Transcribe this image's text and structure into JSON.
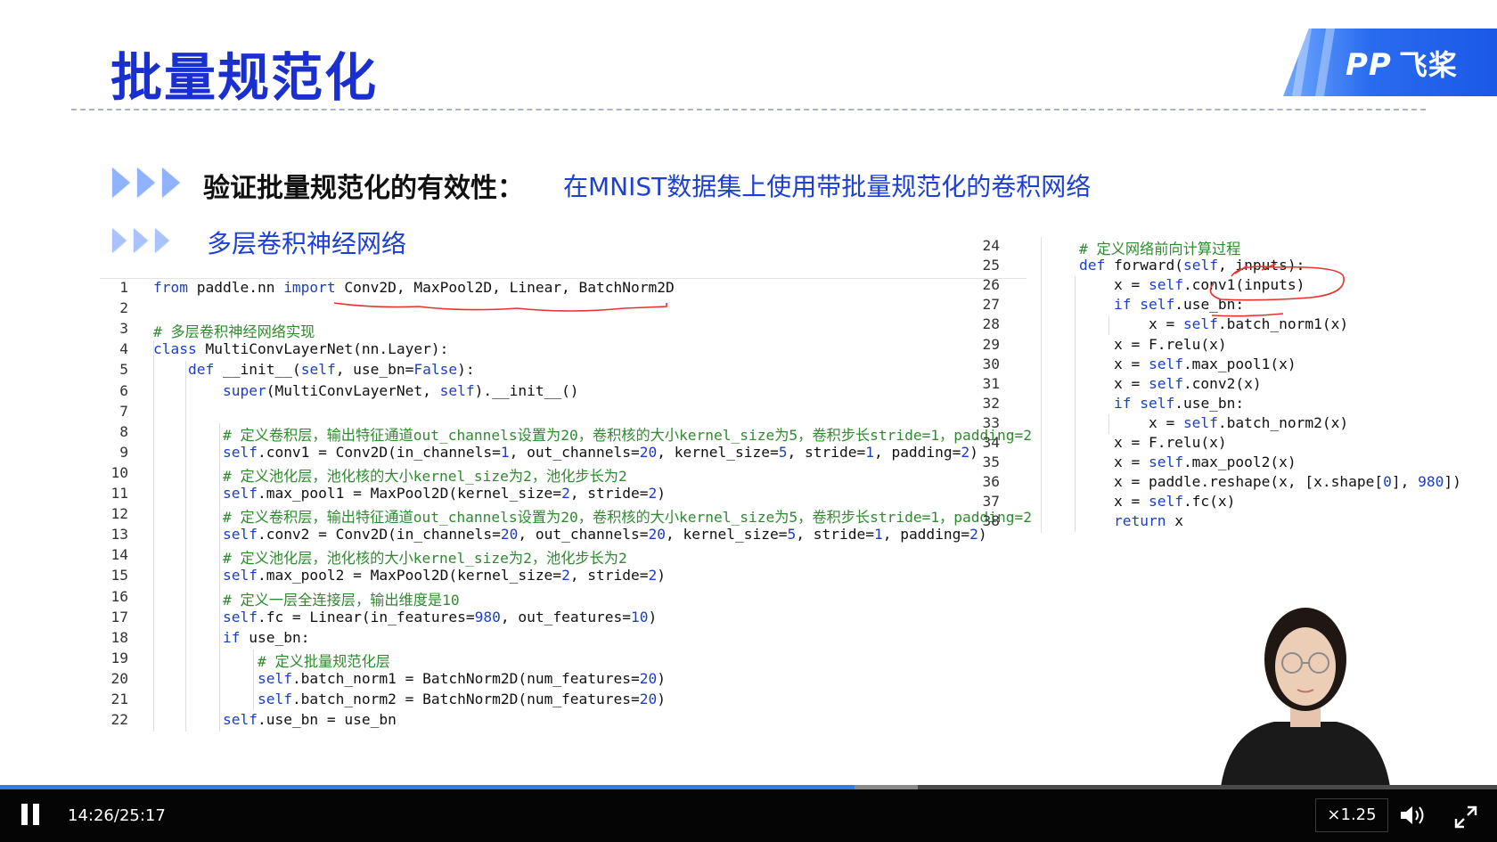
{
  "slide": {
    "title": "批量规范化",
    "brand": "飞桨",
    "brand_mark": "PP",
    "heading1": "验证批量规范化的有效性：",
    "heading1_desc": "在MNIST数据集上使用带批量规范化的卷积网络",
    "heading2": "多层卷积神经网络"
  },
  "code_left": [
    {
      "n": "1",
      "text": "from paddle.nn import Conv2D, MaxPool2D, Linear, BatchNorm2D"
    },
    {
      "n": "2",
      "text": ""
    },
    {
      "n": "3",
      "text": "# 多层卷积神经网络实现"
    },
    {
      "n": "4",
      "text": "class MultiConvLayerNet(nn.Layer):"
    },
    {
      "n": "5",
      "text": "    def __init__(self, use_bn=False):"
    },
    {
      "n": "6",
      "text": "        super(MultiConvLayerNet, self).__init__()"
    },
    {
      "n": "7",
      "text": ""
    },
    {
      "n": "8",
      "text": "        # 定义卷积层，输出特征通道out_channels设置为20，卷积核的大小kernel_size为5，卷积步长stride=1，padding=2"
    },
    {
      "n": "9",
      "text": "        self.conv1 = Conv2D(in_channels=1, out_channels=20, kernel_size=5, stride=1, padding=2)"
    },
    {
      "n": "10",
      "text": "        # 定义池化层，池化核的大小kernel_size为2，池化步长为2"
    },
    {
      "n": "11",
      "text": "        self.max_pool1 = MaxPool2D(kernel_size=2, stride=2)"
    },
    {
      "n": "12",
      "text": "        # 定义卷积层，输出特征通道out_channels设置为20，卷积核的大小kernel_size为5，卷积步长stride=1，padding=2"
    },
    {
      "n": "13",
      "text": "        self.conv2 = Conv2D(in_channels=20, out_channels=20, kernel_size=5, stride=1, padding=2)"
    },
    {
      "n": "14",
      "text": "        # 定义池化层，池化核的大小kernel_size为2，池化步长为2"
    },
    {
      "n": "15",
      "text": "        self.max_pool2 = MaxPool2D(kernel_size=2, stride=2)"
    },
    {
      "n": "16",
      "text": "        # 定义一层全连接层，输出维度是10"
    },
    {
      "n": "17",
      "text": "        self.fc = Linear(in_features=980, out_features=10)"
    },
    {
      "n": "18",
      "text": "        if use_bn:"
    },
    {
      "n": "19",
      "text": "            # 定义批量规范化层"
    },
    {
      "n": "20",
      "text": "            self.batch_norm1 = BatchNorm2D(num_features=20)"
    },
    {
      "n": "21",
      "text": "            self.batch_norm2 = BatchNorm2D(num_features=20)"
    },
    {
      "n": "22",
      "text": "        self.use_bn = use_bn"
    }
  ],
  "code_right": [
    {
      "n": "24",
      "text": "    # 定义网络前向计算过程"
    },
    {
      "n": "25",
      "text": "    def forward(self, inputs):"
    },
    {
      "n": "26",
      "text": "        x = self.conv1(inputs)"
    },
    {
      "n": "27",
      "text": "        if self.use_bn:"
    },
    {
      "n": "28",
      "text": "            x = self.batch_norm1(x)"
    },
    {
      "n": "29",
      "text": "        x = F.relu(x)"
    },
    {
      "n": "30",
      "text": "        x = self.max_pool1(x)"
    },
    {
      "n": "31",
      "text": "        x = self.conv2(x)"
    },
    {
      "n": "32",
      "text": "        if self.use_bn:"
    },
    {
      "n": "33",
      "text": "            x = self.batch_norm2(x)"
    },
    {
      "n": "34",
      "text": "        x = F.relu(x)"
    },
    {
      "n": "35",
      "text": "        x = self.max_pool2(x)"
    },
    {
      "n": "36",
      "text": "        x = paddle.reshape(x, [x.shape[0], 980])"
    },
    {
      "n": "37",
      "text": "        x = self.fc(x)"
    },
    {
      "n": "38",
      "text": "        return x"
    }
  ],
  "player": {
    "current_time": "14:26",
    "separator": "/",
    "duration": "25:17",
    "speed": "×1.25",
    "progress": 0.571,
    "buffered": 0.613,
    "icons": [
      "pause-icon",
      "volume-icon",
      "fullscreen-icon"
    ]
  },
  "colors": {
    "title": "#1a2fd0",
    "accent": "#1d3fd4",
    "keyword": "#1b3fc4",
    "comment": "#2f8a2f",
    "progress": "#2f7fe0",
    "annotation": "#e8312f"
  }
}
